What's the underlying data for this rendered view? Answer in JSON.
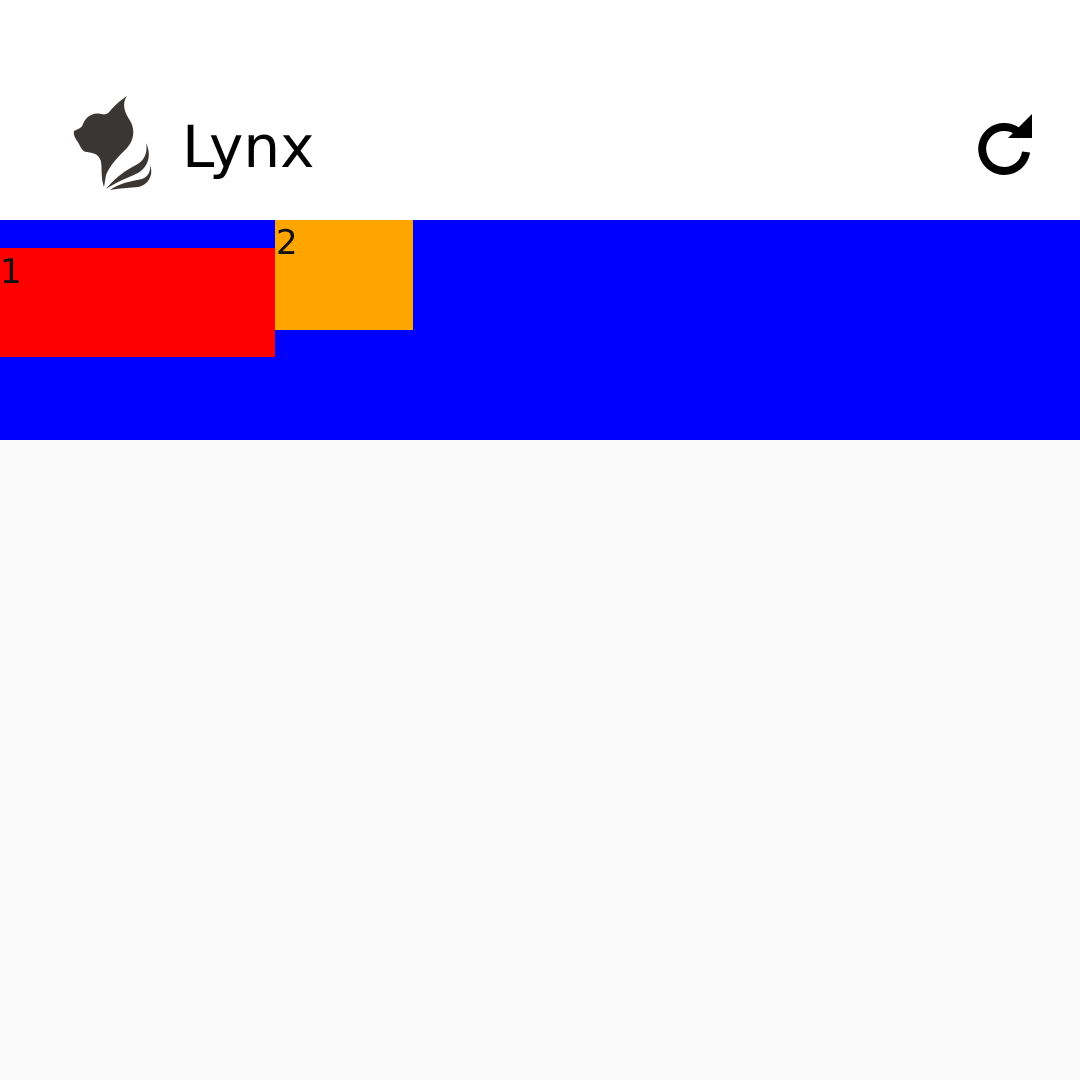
{
  "app_bar": {
    "title": "Lynx",
    "logo_icon": "lynx-head-logo",
    "reload_icon": "reload-icon",
    "background": "#ffffff"
  },
  "content": {
    "background": "#0000ff",
    "items": [
      {
        "label": "1",
        "color": "#ff0000"
      },
      {
        "label": "2",
        "color": "#ffa500"
      }
    ]
  },
  "page": {
    "background": "#f9f9f9"
  }
}
